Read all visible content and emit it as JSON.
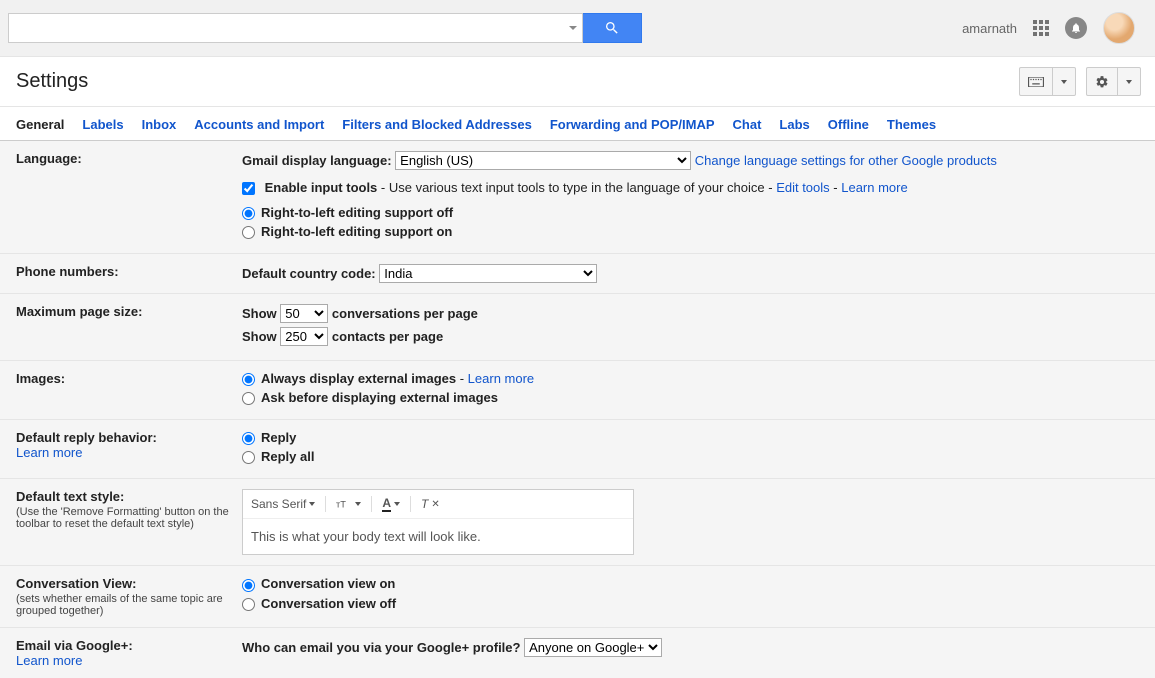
{
  "header": {
    "username": "amarnath"
  },
  "pageTitle": "Settings",
  "tabs": [
    "General",
    "Labels",
    "Inbox",
    "Accounts and Import",
    "Filters and Blocked Addresses",
    "Forwarding and POP/IMAP",
    "Chat",
    "Labs",
    "Offline",
    "Themes"
  ],
  "activeTab": "General",
  "language": {
    "label": "Language:",
    "displayLabel": "Gmail display language:",
    "displayValue": "English (US)",
    "changeLink": "Change language settings for other Google products",
    "enableInputLabel": "Enable input tools",
    "enableInputDesc": " - Use various text input tools to type in the language of your choice - ",
    "editTools": "Edit tools",
    "dash": " - ",
    "learnMore": "Learn more",
    "rtlOff": "Right-to-left editing support off",
    "rtlOn": "Right-to-left editing support on"
  },
  "phone": {
    "label": "Phone numbers:",
    "codeLabel": "Default country code:",
    "codeValue": "India"
  },
  "pageSize": {
    "label": "Maximum page size:",
    "show": "Show",
    "conv": "50",
    "convSuffix": "conversations per page",
    "contacts": "250",
    "contactsSuffix": "contacts per page"
  },
  "images": {
    "label": "Images:",
    "always": "Always display external images",
    "learnMore": "Learn more",
    "ask": "Ask before displaying external images"
  },
  "reply": {
    "label": "Default reply behavior:",
    "learnMore": "Learn more",
    "reply": "Reply",
    "replyAll": "Reply all"
  },
  "textStyle": {
    "label": "Default text style:",
    "hint": "(Use the 'Remove Formatting' button on the toolbar to reset the default text style)",
    "font": "Sans Serif",
    "preview": "This is what your body text will look like."
  },
  "conversation": {
    "label": "Conversation View:",
    "hint": "(sets whether emails of the same topic are grouped together)",
    "on": "Conversation view on",
    "off": "Conversation view off"
  },
  "googlePlus": {
    "label": "Email via Google+:",
    "learnMore": "Learn more",
    "who": "Who can email you via your Google+ profile?",
    "value": "Anyone on Google+"
  }
}
